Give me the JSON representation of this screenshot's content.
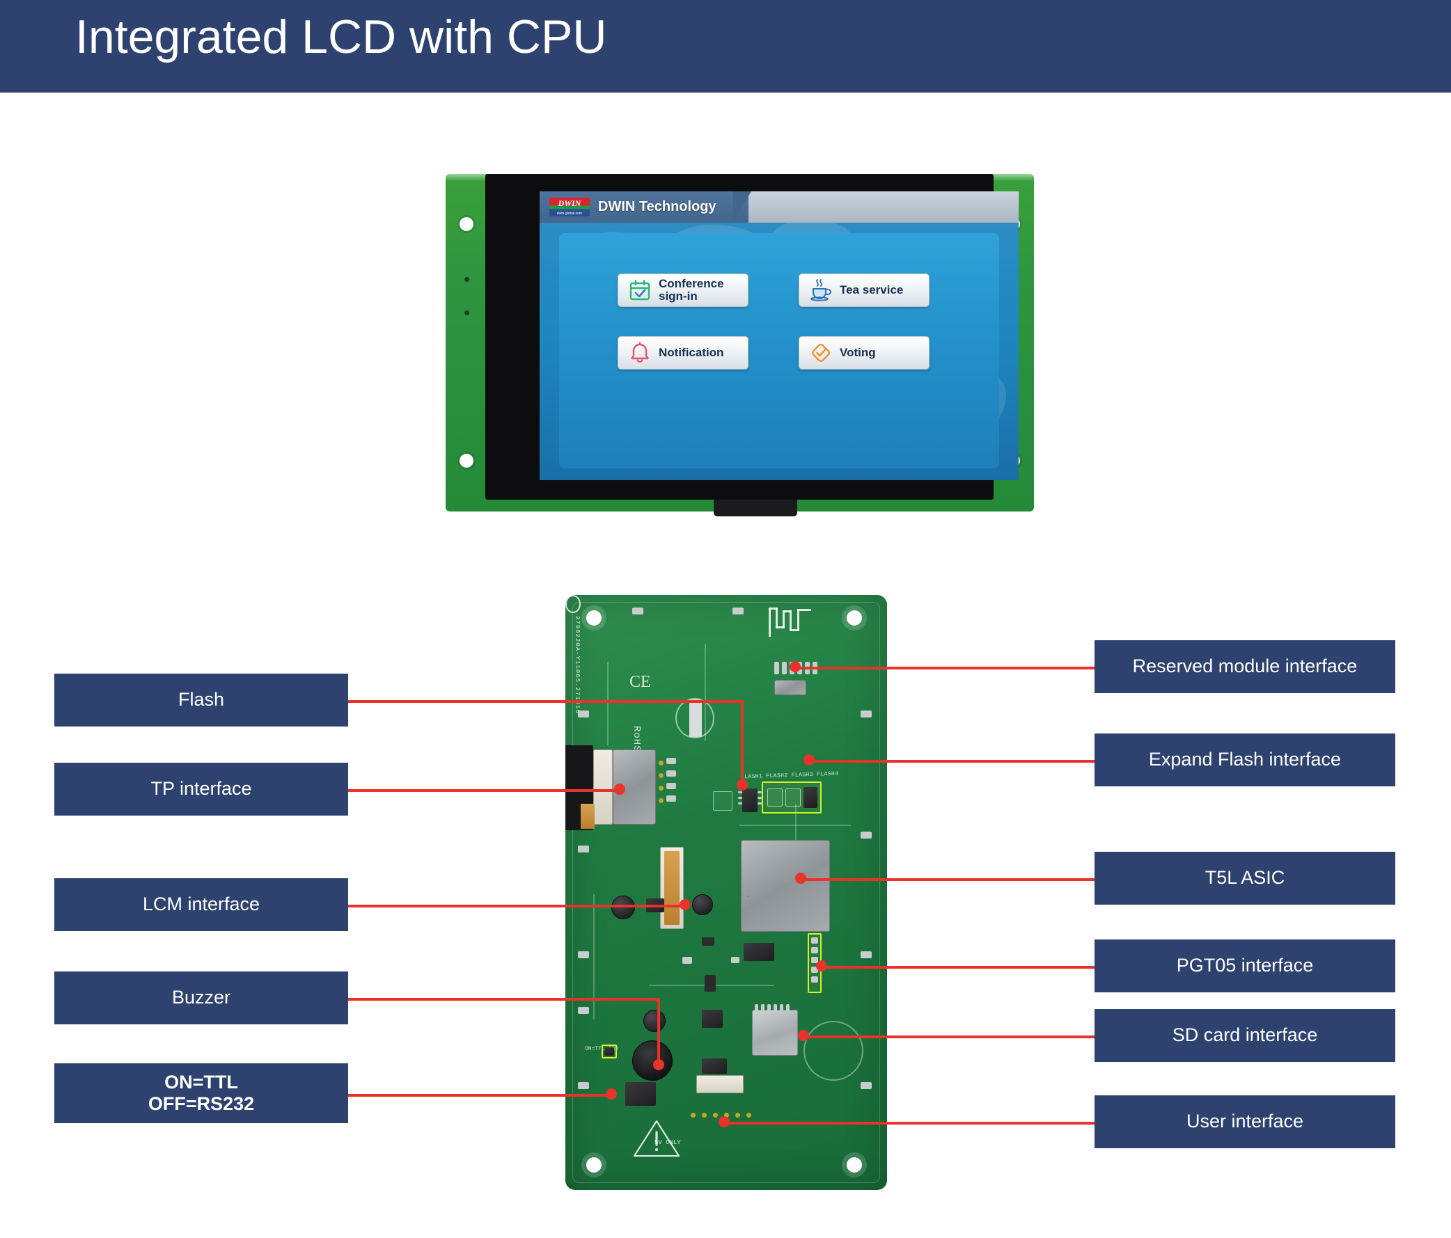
{
  "header": {
    "title": "Integrated LCD with CPU"
  },
  "lcd_screen": {
    "brand_logo": "dwin-logo",
    "brand_logo_text": "DWIN",
    "brand_logo_sub": "dwin-global.com",
    "topbar_title": "DWIN Technology",
    "buttons": [
      {
        "label": "Conference\nsign-in",
        "icon": "calendar-check-icon",
        "icon_color": "#2bb673"
      },
      {
        "label": "Tea service",
        "icon": "teacup-icon",
        "icon_color": "#2b6fb8"
      },
      {
        "label": "Notification",
        "icon": "bell-icon",
        "icon_color": "#e8556f"
      },
      {
        "label": "Voting",
        "icon": "diamond-check-icon",
        "icon_color": "#f0922b"
      }
    ]
  },
  "pcb_silkscreen": {
    "serial": "2798220A-Y11065.271016",
    "ce_mark": "CE",
    "rohs_mark": "RoHS",
    "flash_row": "FLASH1 FLASH2 FLASH3 FLASH4",
    "jumper": "ON=TTL\n232",
    "power_warning": "5V ONLY"
  },
  "callouts": {
    "left": [
      {
        "label": "Flash"
      },
      {
        "label": "TP interface"
      },
      {
        "label": "LCM interface"
      },
      {
        "label": "Buzzer"
      },
      {
        "label": "ON=TTL\nOFF=RS232"
      }
    ],
    "right": [
      {
        "label": "Reserved module interface"
      },
      {
        "label": "Expand Flash interface"
      },
      {
        "label": "T5L ASIC"
      },
      {
        "label": "PGT05 interface"
      },
      {
        "label": "SD card interface"
      },
      {
        "label": "User interface"
      }
    ]
  },
  "colors": {
    "banner": "#2e4270",
    "callout_bg": "#2e4270",
    "leader_line": "#e8322a",
    "pcb_green": "#1f7a40",
    "highlight_yellow": "#d8ef2a"
  }
}
